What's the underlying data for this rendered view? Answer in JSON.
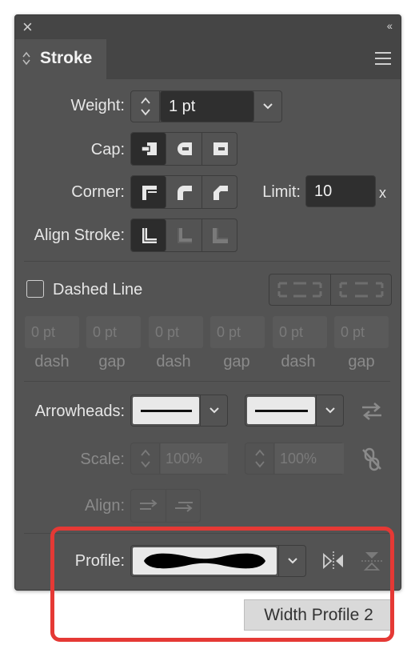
{
  "panel": {
    "tab_label": "Stroke"
  },
  "weight": {
    "label": "Weight:",
    "value": "1 pt"
  },
  "cap": {
    "label": "Cap:"
  },
  "corner": {
    "label": "Corner:",
    "limit_label": "Limit:",
    "limit_value": "10",
    "limit_unit": "x"
  },
  "align_stroke": {
    "label": "Align Stroke:"
  },
  "dashed": {
    "label": "Dashed Line",
    "checked": false,
    "fields": [
      {
        "value": "0 pt",
        "caption": "dash"
      },
      {
        "value": "0 pt",
        "caption": "gap"
      },
      {
        "value": "0 pt",
        "caption": "dash"
      },
      {
        "value": "0 pt",
        "caption": "gap"
      },
      {
        "value": "0 pt",
        "caption": "dash"
      },
      {
        "value": "0 pt",
        "caption": "gap"
      }
    ]
  },
  "arrowheads": {
    "label": "Arrowheads:"
  },
  "scale": {
    "label": "Scale:",
    "start": "100%",
    "end": "100%"
  },
  "align": {
    "label": "Align:"
  },
  "profile": {
    "label": "Profile:"
  },
  "tooltip": {
    "text": "Width Profile 2"
  },
  "colors": {
    "panel": "#535353",
    "selected": "#2c2c2c",
    "highlight": "#e53935"
  }
}
